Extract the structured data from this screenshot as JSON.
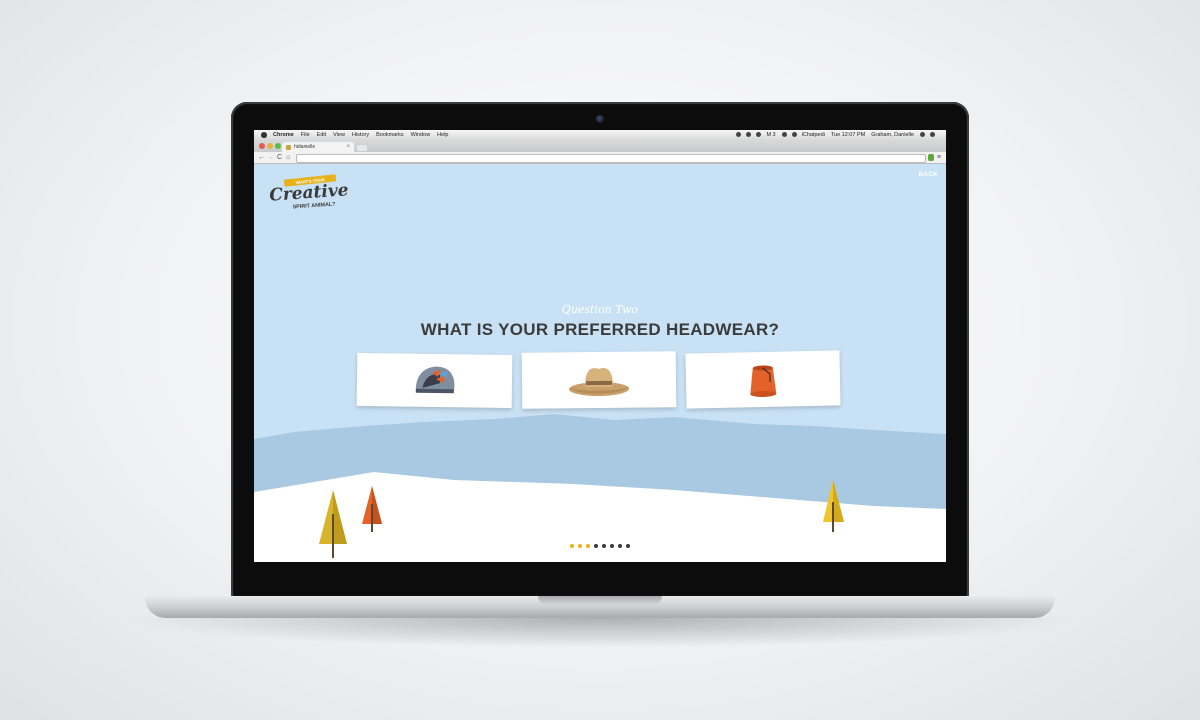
{
  "os_menubar": {
    "app_name": "Chrome",
    "menus": [
      "File",
      "Edit",
      "View",
      "History",
      "Bookmarks",
      "Window",
      "Help"
    ],
    "status_items": [
      "M 3",
      "iChatpedi",
      "Tue 12:07 PM",
      "Graham, Danielle"
    ]
  },
  "browser": {
    "tab_title": "hidanielle",
    "nav": {
      "back": "←",
      "forward": "→",
      "reload": "C",
      "home": "⌂",
      "menu": "≡"
    }
  },
  "page": {
    "logo": {
      "tagline_top": "WHAT'S YOUR",
      "title": "Creative",
      "subtitle": "SPIRIT ANIMAL?"
    },
    "back_label": "BACK",
    "question_label": "Question Two",
    "question_title": "WHAT IS YOUR PREFERRED HEADWEAR?",
    "answers": [
      {
        "icon": "racing-helmet-icon"
      },
      {
        "icon": "cowboy-hat-icon"
      },
      {
        "icon": "fez-icon"
      }
    ],
    "progress": {
      "total": 8,
      "completed": 3
    },
    "colors": {
      "sky": "#c9e1f4",
      "hills": "#a8c9e2",
      "snow": "#ffffff",
      "accent": "#e8b21b",
      "text": "#3b3b3b"
    }
  }
}
